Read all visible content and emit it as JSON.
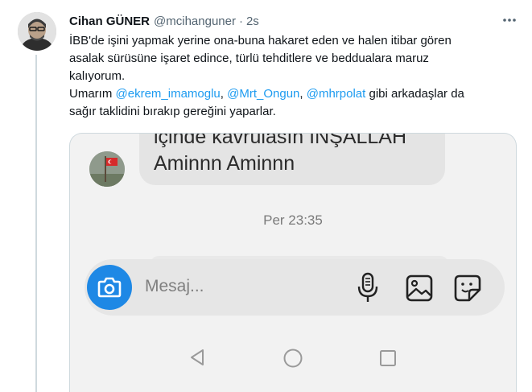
{
  "tweet": {
    "author_name": "Cihan GÜNER",
    "handle": "@mcihanguner",
    "separator": "·",
    "time": "2s",
    "line1": "İBB'de işini yapmak yerine ona-buna hakaret eden ve halen itibar gören",
    "line2": "asalak sürüsüne işaret edince, türlü tehditlere ve beddualara maruz",
    "line3": "kalıyorum.",
    "line4_prefix": "Umarım ",
    "mention1": "@ekrem_imamoglu",
    "comma1": ", ",
    "mention2": "@Mrt_Ongun",
    "comma2": ", ",
    "mention3": "@mhrpolat",
    "line4_suffix": " gibi arkadaşlar da",
    "line5": "sağır taklidini bırakıp gereğini yaparlar."
  },
  "screenshot": {
    "bubble_line1": "içinde kavrulasın İNŞALLAH",
    "bubble_line2": "Aminnn Aminnn",
    "timestamp": "Per 23:35",
    "input_placeholder": "Mesaj..."
  },
  "icons": {
    "more": "more-options-icon",
    "camera": "camera-icon",
    "mic": "microphone-icon",
    "gallery": "image-icon",
    "sticker": "sticker-icon",
    "back": "nav-back-icon",
    "home": "nav-home-icon",
    "recent": "nav-recent-icon"
  },
  "colors": {
    "mention": "#1d9bf0",
    "camera_button": "#1e88e5",
    "muted": "#536471"
  }
}
